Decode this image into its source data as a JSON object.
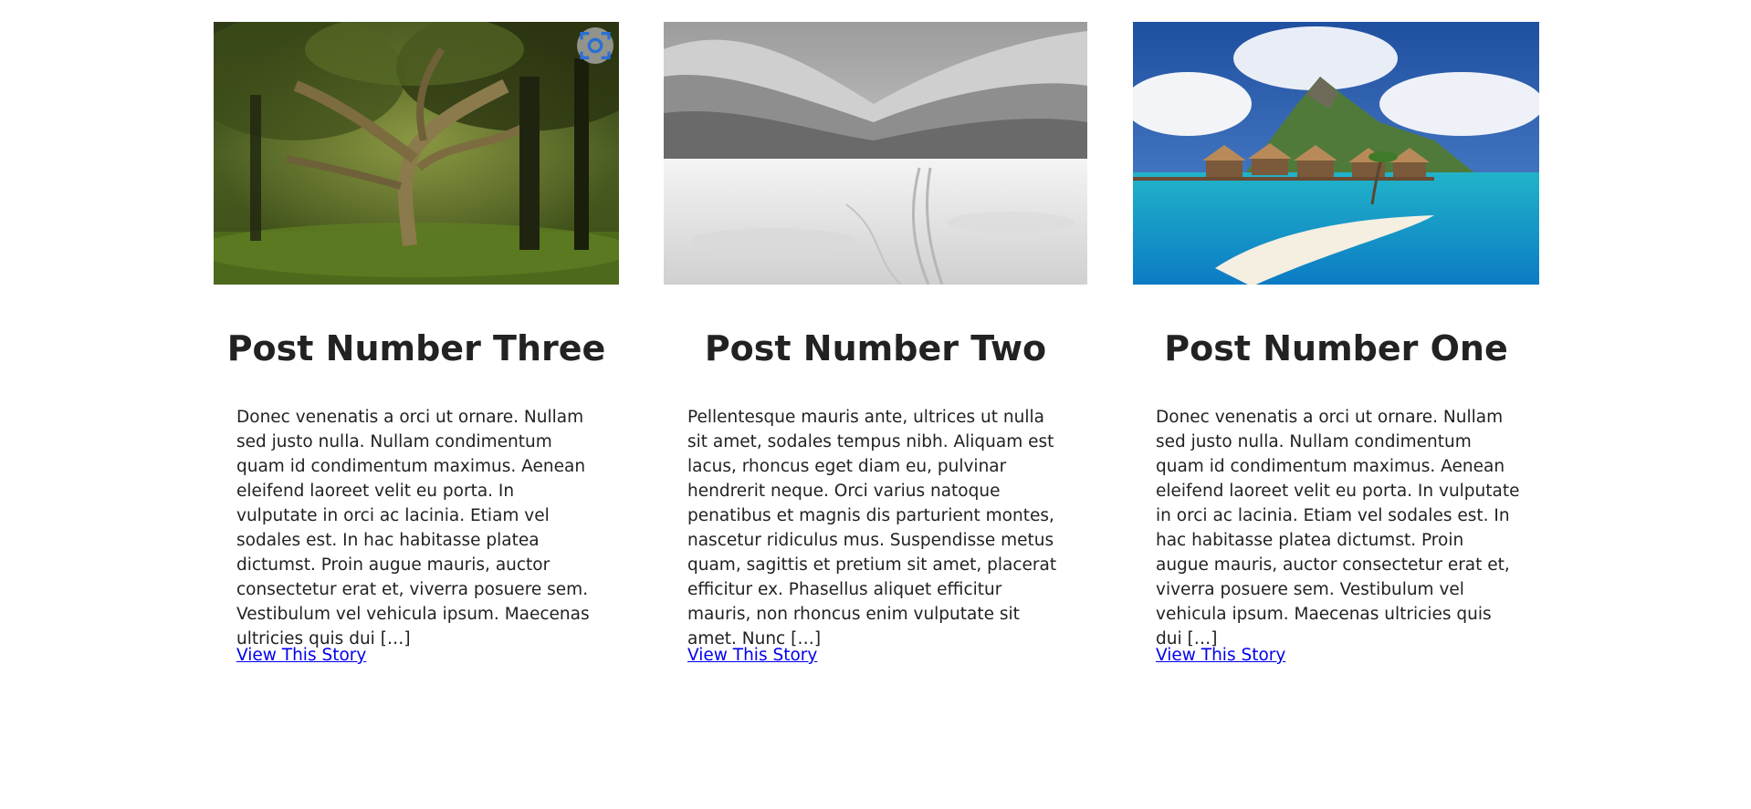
{
  "posts": [
    {
      "title": "Post Number Three",
      "excerpt": "Donec venenatis a orci ut ornare. Nullam sed justo nulla. Nullam condimentum quam id condimentum maximus. Aenean eleifend laoreet velit eu porta. In vulputate in orci ac lacinia. Etiam vel sodales est. In hac habitasse platea dictumst. Proin augue mauris, auctor consectetur erat et, viverra posuere sem. Vestibulum vel vehicula ipsum. Maecenas ultricies quis dui […]",
      "link_label": "View This Story",
      "image": "forest-trees-photo"
    },
    {
      "title": "Post Number Two",
      "excerpt": "Pellentesque mauris ante, ultrices ut nulla sit amet, sodales tempus nibh. Aliquam est lacus, rhoncus eget diam eu, pulvinar hendrerit neque. Orci varius natoque penatibus et magnis dis parturient montes, nascetur ridiculus mus. Suspendisse metus quam, sagittis et pretium sit amet, placerat efficitur ex. Phasellus aliquet efficitur mauris, non rhoncus enim vulputate sit amet. Nunc […]",
      "link_label": "View This Story",
      "image": "snowy-mountain-valley-photo"
    },
    {
      "title": "Post Number One",
      "excerpt": "Donec venenatis a orci ut ornare. Nullam sed justo nulla. Nullam condimentum quam id condimentum maximus. Aenean eleifend laoreet velit eu porta. In vulputate in orci ac lacinia. Etiam vel sodales est. In hac habitasse platea dictumst. Proin augue mauris, auctor consectetur erat et, viverra posuere sem. Vestibulum vel vehicula ipsum. Maecenas ultricies quis dui […]",
      "link_label": "View This Story",
      "image": "tropical-island-bungalows-photo"
    }
  ],
  "image_overlay_icon": "visual-search-icon",
  "colors": {
    "text": "#222222",
    "link": "#0000ee",
    "background": "#ffffff"
  }
}
